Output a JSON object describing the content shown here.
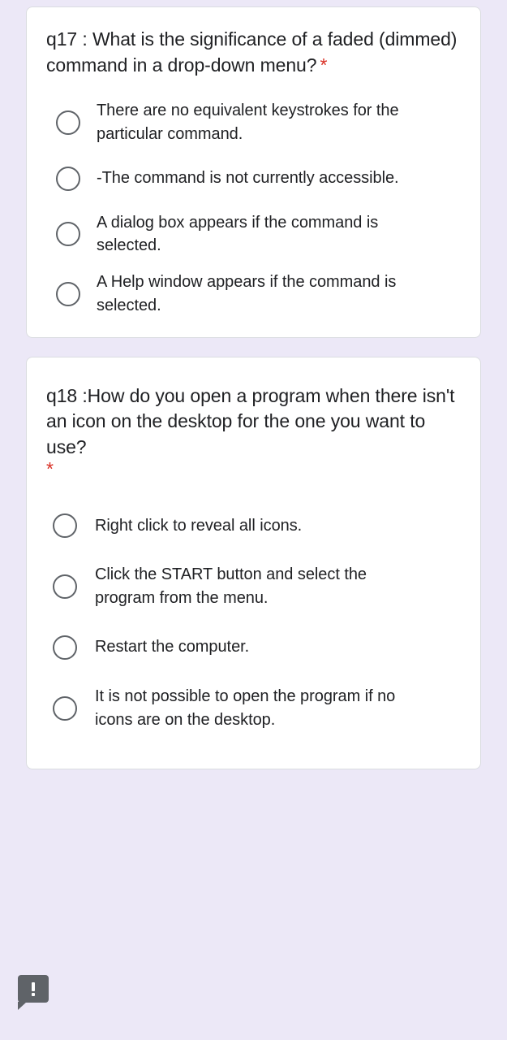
{
  "theme": {
    "page_background": "#ece8f7",
    "card_background": "#ffffff",
    "card_border": "#dadce0",
    "text_color": "#202124",
    "required_star_color": "#d93025",
    "radio_border_color": "#5f6368"
  },
  "questions": [
    {
      "id": "q17",
      "title": "q17 : What is the significance of a faded (dimmed) command in a drop-down menu?",
      "required_marker": "*",
      "required_marker_inline": true,
      "options": [
        {
          "label": "There are no equivalent keystrokes for the particular command.",
          "selected": false
        },
        {
          "label": "-The command is not currently accessible.",
          "selected": false
        },
        {
          "label": "A dialog box appears if the command is selected.",
          "selected": false
        },
        {
          "label": "A Help window appears if the command is selected.",
          "selected": false
        }
      ]
    },
    {
      "id": "q18",
      "title": "q18 :How do you open a program when there isn't an icon on the desktop for the one you want to use?",
      "required_marker": "*",
      "required_marker_inline": false,
      "options": [
        {
          "label": "Right click to reveal all icons.",
          "selected": false
        },
        {
          "label": "Click the START button and select the program from the menu.",
          "selected": false
        },
        {
          "label": "Restart the computer.",
          "selected": false
        },
        {
          "label": "It is not possible to open the program if no icons are on the desktop.",
          "selected": false
        }
      ]
    }
  ],
  "feedback_tab": {
    "icon": "exclamation-icon",
    "label": "!"
  }
}
